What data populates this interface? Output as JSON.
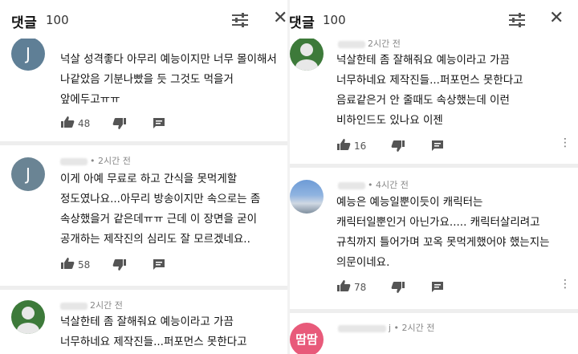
{
  "left": {
    "header": {
      "title": "댓글",
      "count": "100"
    },
    "comments": [
      {
        "avatar": "J",
        "meta": "",
        "text": "넉살 성격좋다 아무리 예능이지만 너무 몰이해서\n나같았음 기분나빴을 듯 그것도 먹을거\n앞에두고ㅠㅠ",
        "likes": "48"
      },
      {
        "avatar": "J",
        "meta": "• 2시간 전",
        "text": "이게 아예 무료로 하고 간식을 못먹게할\n정도였나요...아무리 방송이지만 속으로는 좀\n속상했을거 같은데ㅠㅠ 근데 이 장면을 굳이\n공개하는 제작진의 심리도 잘 모르겠네요..",
        "likes": "58"
      },
      {
        "avatar": "",
        "meta": "2시간 전",
        "text": "넉살한테 좀 잘해줘요 예능이라고 가끔\n너무하네요 제작진들...퍼포먼스 못한다고",
        "likes": ""
      }
    ]
  },
  "right": {
    "header": {
      "title": "댓글",
      "count": "100"
    },
    "comments": [
      {
        "avatar": "",
        "meta": "2시간 전",
        "text": "넉살한테 좀 잘해줘요 예능이라고 가끔\n너무하네요 제작진들...퍼포먼스 못한다고\n음료같은거 안 줄때도 속상했는데 이런\n비하인드도 있나요 이젠",
        "likes": "16"
      },
      {
        "avatar": "",
        "meta": "• 4시간 전",
        "text": "예능은 예능일뿐이듯이 캐릭터는\n캐릭터일뿐인거 아닌가요..... 캐릭터살리려고\n규칙까지 틀어가며 꼬옥 못먹게했어야 했는지는\n의문이네요.",
        "likes": "78"
      },
      {
        "avatar": "땀땀",
        "meta": "j • 2시간 전",
        "text": "",
        "likes": ""
      }
    ]
  }
}
